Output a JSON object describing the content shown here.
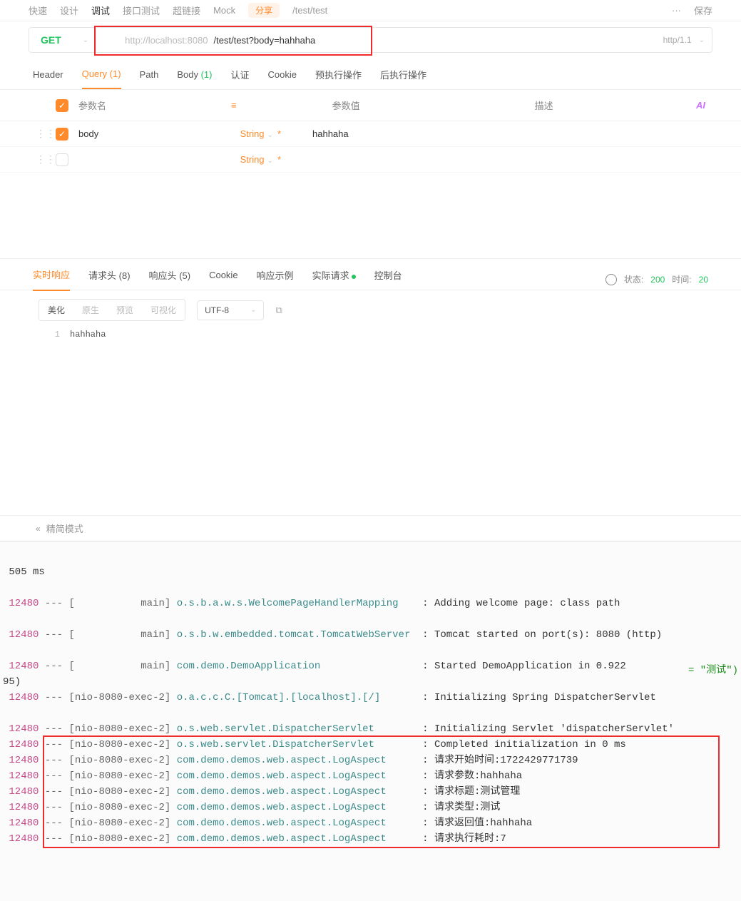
{
  "topTabs": {
    "t1": "快速",
    "t2": "设计",
    "t3": "调试",
    "t4": "接口测试",
    "t5": "超链接",
    "t6": "Mock",
    "badge": "分享",
    "path": "/test/test",
    "more": "···",
    "save": "保存"
  },
  "url": {
    "method": "GET",
    "host": "http://localhost:8080",
    "path": "/test/test?body=hahhaha",
    "proto": "http/1.1"
  },
  "reqTabs": {
    "header": "Header",
    "query": "Query",
    "queryCount": "(1)",
    "path": "Path",
    "body": "Body",
    "bodyCount": "(1)",
    "auth": "认证",
    "cookie": "Cookie",
    "pre": "预执行操作",
    "post": "后执行操作"
  },
  "paramHdr": {
    "name": "参数名",
    "value": "参数值",
    "desc": "描述",
    "ai": "AI"
  },
  "params": [
    {
      "name": "body",
      "type": "String",
      "value": "hahhaha"
    },
    {
      "name": "",
      "type": "String",
      "value": ""
    }
  ],
  "respTabs": {
    "realtime": "实时响应",
    "reqh": "请求头",
    "reqhc": "(8)",
    "resh": "响应头",
    "reshc": "(5)",
    "cookie": "Cookie",
    "example": "响应示例",
    "actual": "实际请求",
    "console": "控制台"
  },
  "status": {
    "label": "状态:",
    "code": "200",
    "timeLabel": "时间:",
    "time": "20"
  },
  "viewer": {
    "pretty": "美化",
    "raw": "原生",
    "preview": "预览",
    "visual": "可视化",
    "encoding": "UTF-8"
  },
  "body": {
    "line": "1",
    "content": "hahhaha"
  },
  "footer": {
    "mode": "精简模式"
  },
  "console": {
    "startup": " 505 ms",
    "annot": "= \"测试\")",
    "lines": [
      {
        "pid": "12480",
        "thr": "[           main]",
        "cls": "o.s.b.a.w.s.WelcomePageHandlerMapping   ",
        "msg": ": Adding welcome page: class path"
      },
      {
        "blank": true
      },
      {
        "pid": "12480",
        "thr": "[           main]",
        "cls": "o.s.b.w.embedded.tomcat.TomcatWebServer ",
        "msg": ": Tomcat started on port(s): 8080 (http)"
      },
      {
        "blank": true
      },
      {
        "pid": "12480",
        "thr": "[           main]",
        "cls": "com.demo.DemoApplication                ",
        "msg": ": Started DemoApplication in 0.922"
      },
      {
        "raw": "95)"
      },
      {
        "pid": "12480",
        "thr": "[nio-8080-exec-2]",
        "cls": "o.a.c.c.C.[Tomcat].[localhost].[/]      ",
        "msg": ": Initializing Spring DispatcherServlet"
      },
      {
        "blank": true
      },
      {
        "pid": "12480",
        "thr": "[nio-8080-exec-2]",
        "cls": "o.s.web.servlet.DispatcherServlet       ",
        "msg": ": Initializing Servlet 'dispatcherServlet'"
      },
      {
        "pid": "12480",
        "thr": "[nio-8080-exec-2]",
        "cls": "o.s.web.servlet.DispatcherServlet       ",
        "msg": ": Completed initialization in 0 ms"
      },
      {
        "pid": "12480",
        "thr": "[nio-8080-exec-2]",
        "cls": "com.demo.demos.web.aspect.LogAspect     ",
        "msg": ": 请求开始时间:1722429771739"
      },
      {
        "pid": "12480",
        "thr": "[nio-8080-exec-2]",
        "cls": "com.demo.demos.web.aspect.LogAspect     ",
        "msg": ": 请求参数:hahhaha"
      },
      {
        "pid": "12480",
        "thr": "[nio-8080-exec-2]",
        "cls": "com.demo.demos.web.aspect.LogAspect     ",
        "msg": ": 请求标题:测试管理"
      },
      {
        "pid": "12480",
        "thr": "[nio-8080-exec-2]",
        "cls": "com.demo.demos.web.aspect.LogAspect     ",
        "msg": ": 请求类型:测试"
      },
      {
        "pid": "12480",
        "thr": "[nio-8080-exec-2]",
        "cls": "com.demo.demos.web.aspect.LogAspect     ",
        "msg": ": 请求返回值:hahhaha"
      },
      {
        "pid": "12480",
        "thr": "[nio-8080-exec-2]",
        "cls": "com.demo.demos.web.aspect.LogAspect     ",
        "msg": ": 请求执行耗时:7"
      }
    ]
  }
}
